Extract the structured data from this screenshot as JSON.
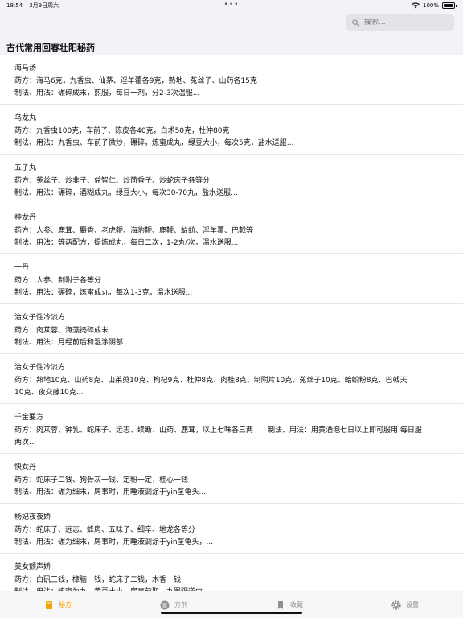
{
  "status": {
    "time": "18:54",
    "date": "3月9日周六",
    "battery": "100%"
  },
  "search": {
    "placeholder": "搜索..."
  },
  "header": {
    "title": "古代常用回春壮阳秘药"
  },
  "items": [
    {
      "title": "海马汤",
      "line1": "药方：海马6克，九香虫、仙茅、淫羊藿各9克，熟地、菟丝子、山药各15克",
      "line2": "制法、用法：碾碎成末，煎服，每日一剂，分2-3次温服..."
    },
    {
      "title": "乌龙丸",
      "line1": "药方：九香虫100克，车前子、陈皮各40克，白术50克，杜仲80克",
      "line2": "制法、用法：九香虫、车前子微炒，碾碎，炼蜜成丸，绿豆大小，每次5克，盐水送服..."
    },
    {
      "title": "五子丸",
      "line1": "药方：菟丝子、炒韭子、益智仁、炒茴香子、炒蛇床子各等分",
      "line2": "制法、用法：碾碎，酒糊成丸，绿豆大小，每次30-70丸，盐水送服..."
    },
    {
      "title": "神龙丹",
      "line1": "药方：人参、鹿茸、麝香、老虎鞭、海豹鞭、鹿鞭、蛤蚧、淫羊藿、巴戟等",
      "line2": "制法、用法：等两配方，提炼成丸，每日二次，1-2丸/次，温水送服..."
    },
    {
      "title": "一丹",
      "line1": "药方：人参、制附子各等分",
      "line2": "制法、用法：碾碎，炼蜜成丸，每次1-3克，温水送服..."
    },
    {
      "title": "治女子性冷淡方",
      "line1": "药方：肉苁蓉、海藻捣碎成末",
      "line2": "制法、用法：月经前后和湿涂阴部..."
    },
    {
      "title": "治女子性冷淡方",
      "line1": "药方：熟地10克、山药8克、山茱萸10克、枸杞9克、杜仲8克、肉桂8克、制附片10克、菟丝子10克、蛤蚧粉8克、巴戟天",
      "line2": "10克、夜交藤10克..."
    },
    {
      "title": "千金要方",
      "line1": "药方：肉苁蓉、钟乳、蛇床子、远志、续断、山药、鹿茸，以上七味各三两　　制法、用法：用黄酒泡七日以上即可服用.每日服",
      "line2": "两次..."
    },
    {
      "title": "快女丹",
      "line1": "药方：蛇床子二钱、狗骨灰一钱、定粉一定，桂心一钱",
      "line2": "制法、用法：碾为细末，房事时，用睡液调涂于yin茎龟头..."
    },
    {
      "title": "杨妃夜夜娇",
      "line1": "药方：蛇床子、远志、蜂房、五味子、细辛、地龙各等分",
      "line2": "制法、用法：碾为细末，房事时，用睡液调涂于yin茎龟头，..."
    },
    {
      "title": "美女颤声娇",
      "line1": "药方：白矾三钱，樟脑一钱，蛇床子二钱，木香一钱",
      "line2": "制法、用法：炼蜜为丸，黄豆大小，房事前取一丸置阴道内..."
    }
  ],
  "tabs": [
    {
      "label": "秘方",
      "icon": "book-icon",
      "active": true
    },
    {
      "label": "方剂",
      "icon": "list-icon",
      "active": false
    },
    {
      "label": "收藏",
      "icon": "bookmark-icon",
      "active": false
    },
    {
      "label": "设置",
      "icon": "gear-icon",
      "active": false
    }
  ],
  "colors": {
    "accent": "#f0a202",
    "inactive": "#8e8e93"
  }
}
